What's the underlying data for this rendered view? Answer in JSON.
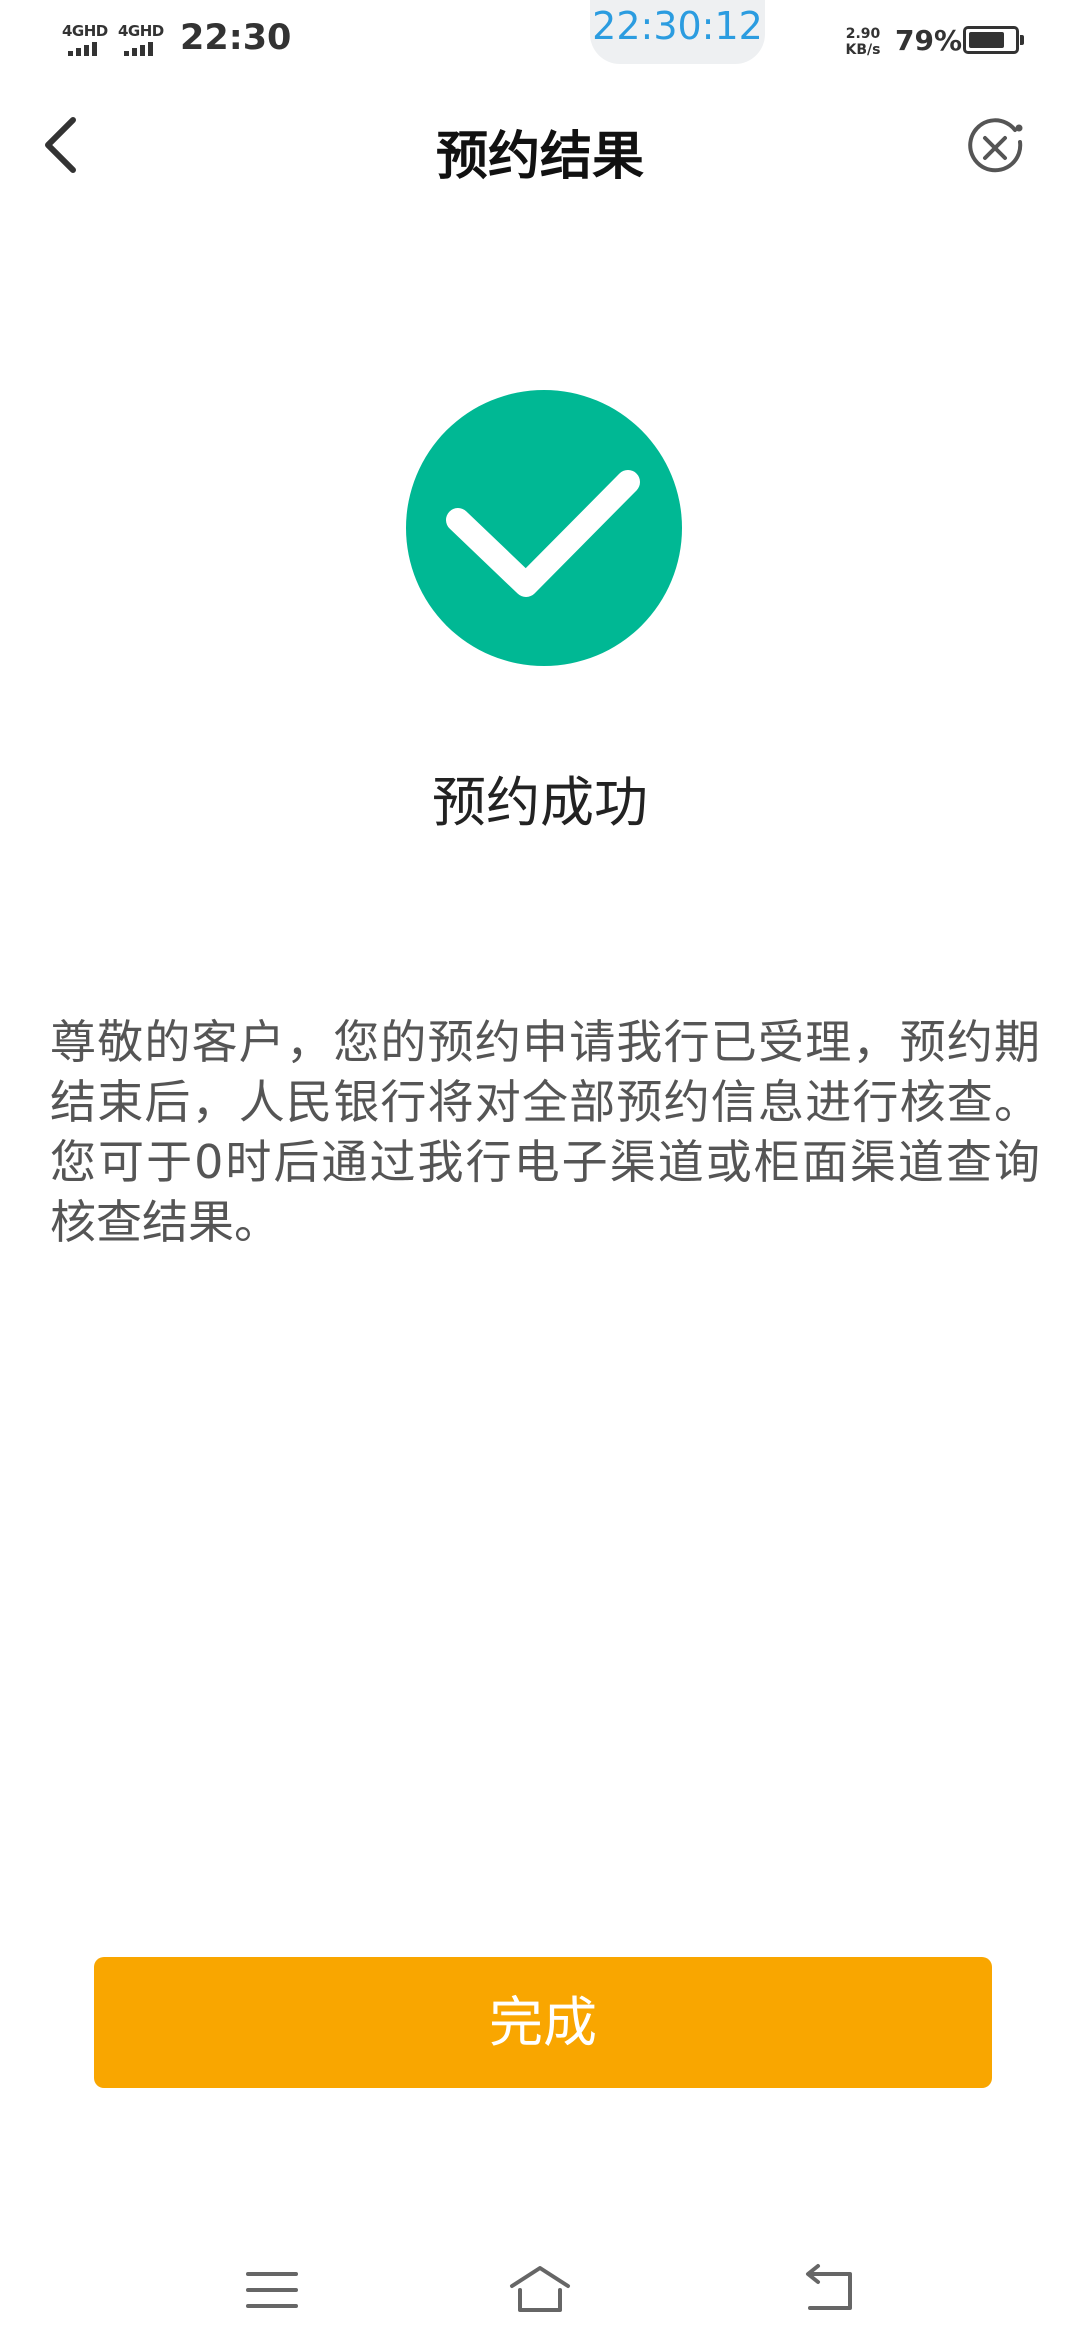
{
  "status_bar": {
    "network_1": "4GHD",
    "network_2": "4GHD",
    "time": "22:30",
    "clock_overlay": "22:30:12",
    "speed_value": "2.90",
    "speed_unit": "KB/s",
    "battery_percent": "79%",
    "battery_level": 0.79
  },
  "nav": {
    "title": "预约结果",
    "back_icon": "chevron-left-icon",
    "close_icon": "close-circle-icon"
  },
  "result": {
    "icon": "check-circle-icon",
    "icon_color": "#00b894",
    "title": "预约成功",
    "message": "尊敬的客户，您的预约申请我行已受理，预约期结束后，人民银行将对全部预约信息进行核查。您可于0时后通过我行电子渠道或柜面渠道查询核查结果。"
  },
  "actions": {
    "done_label": "完成",
    "done_color": "#f9a600"
  },
  "system_nav": {
    "menu_icon": "menu-icon",
    "home_icon": "home-icon",
    "back_icon": "back-icon"
  }
}
